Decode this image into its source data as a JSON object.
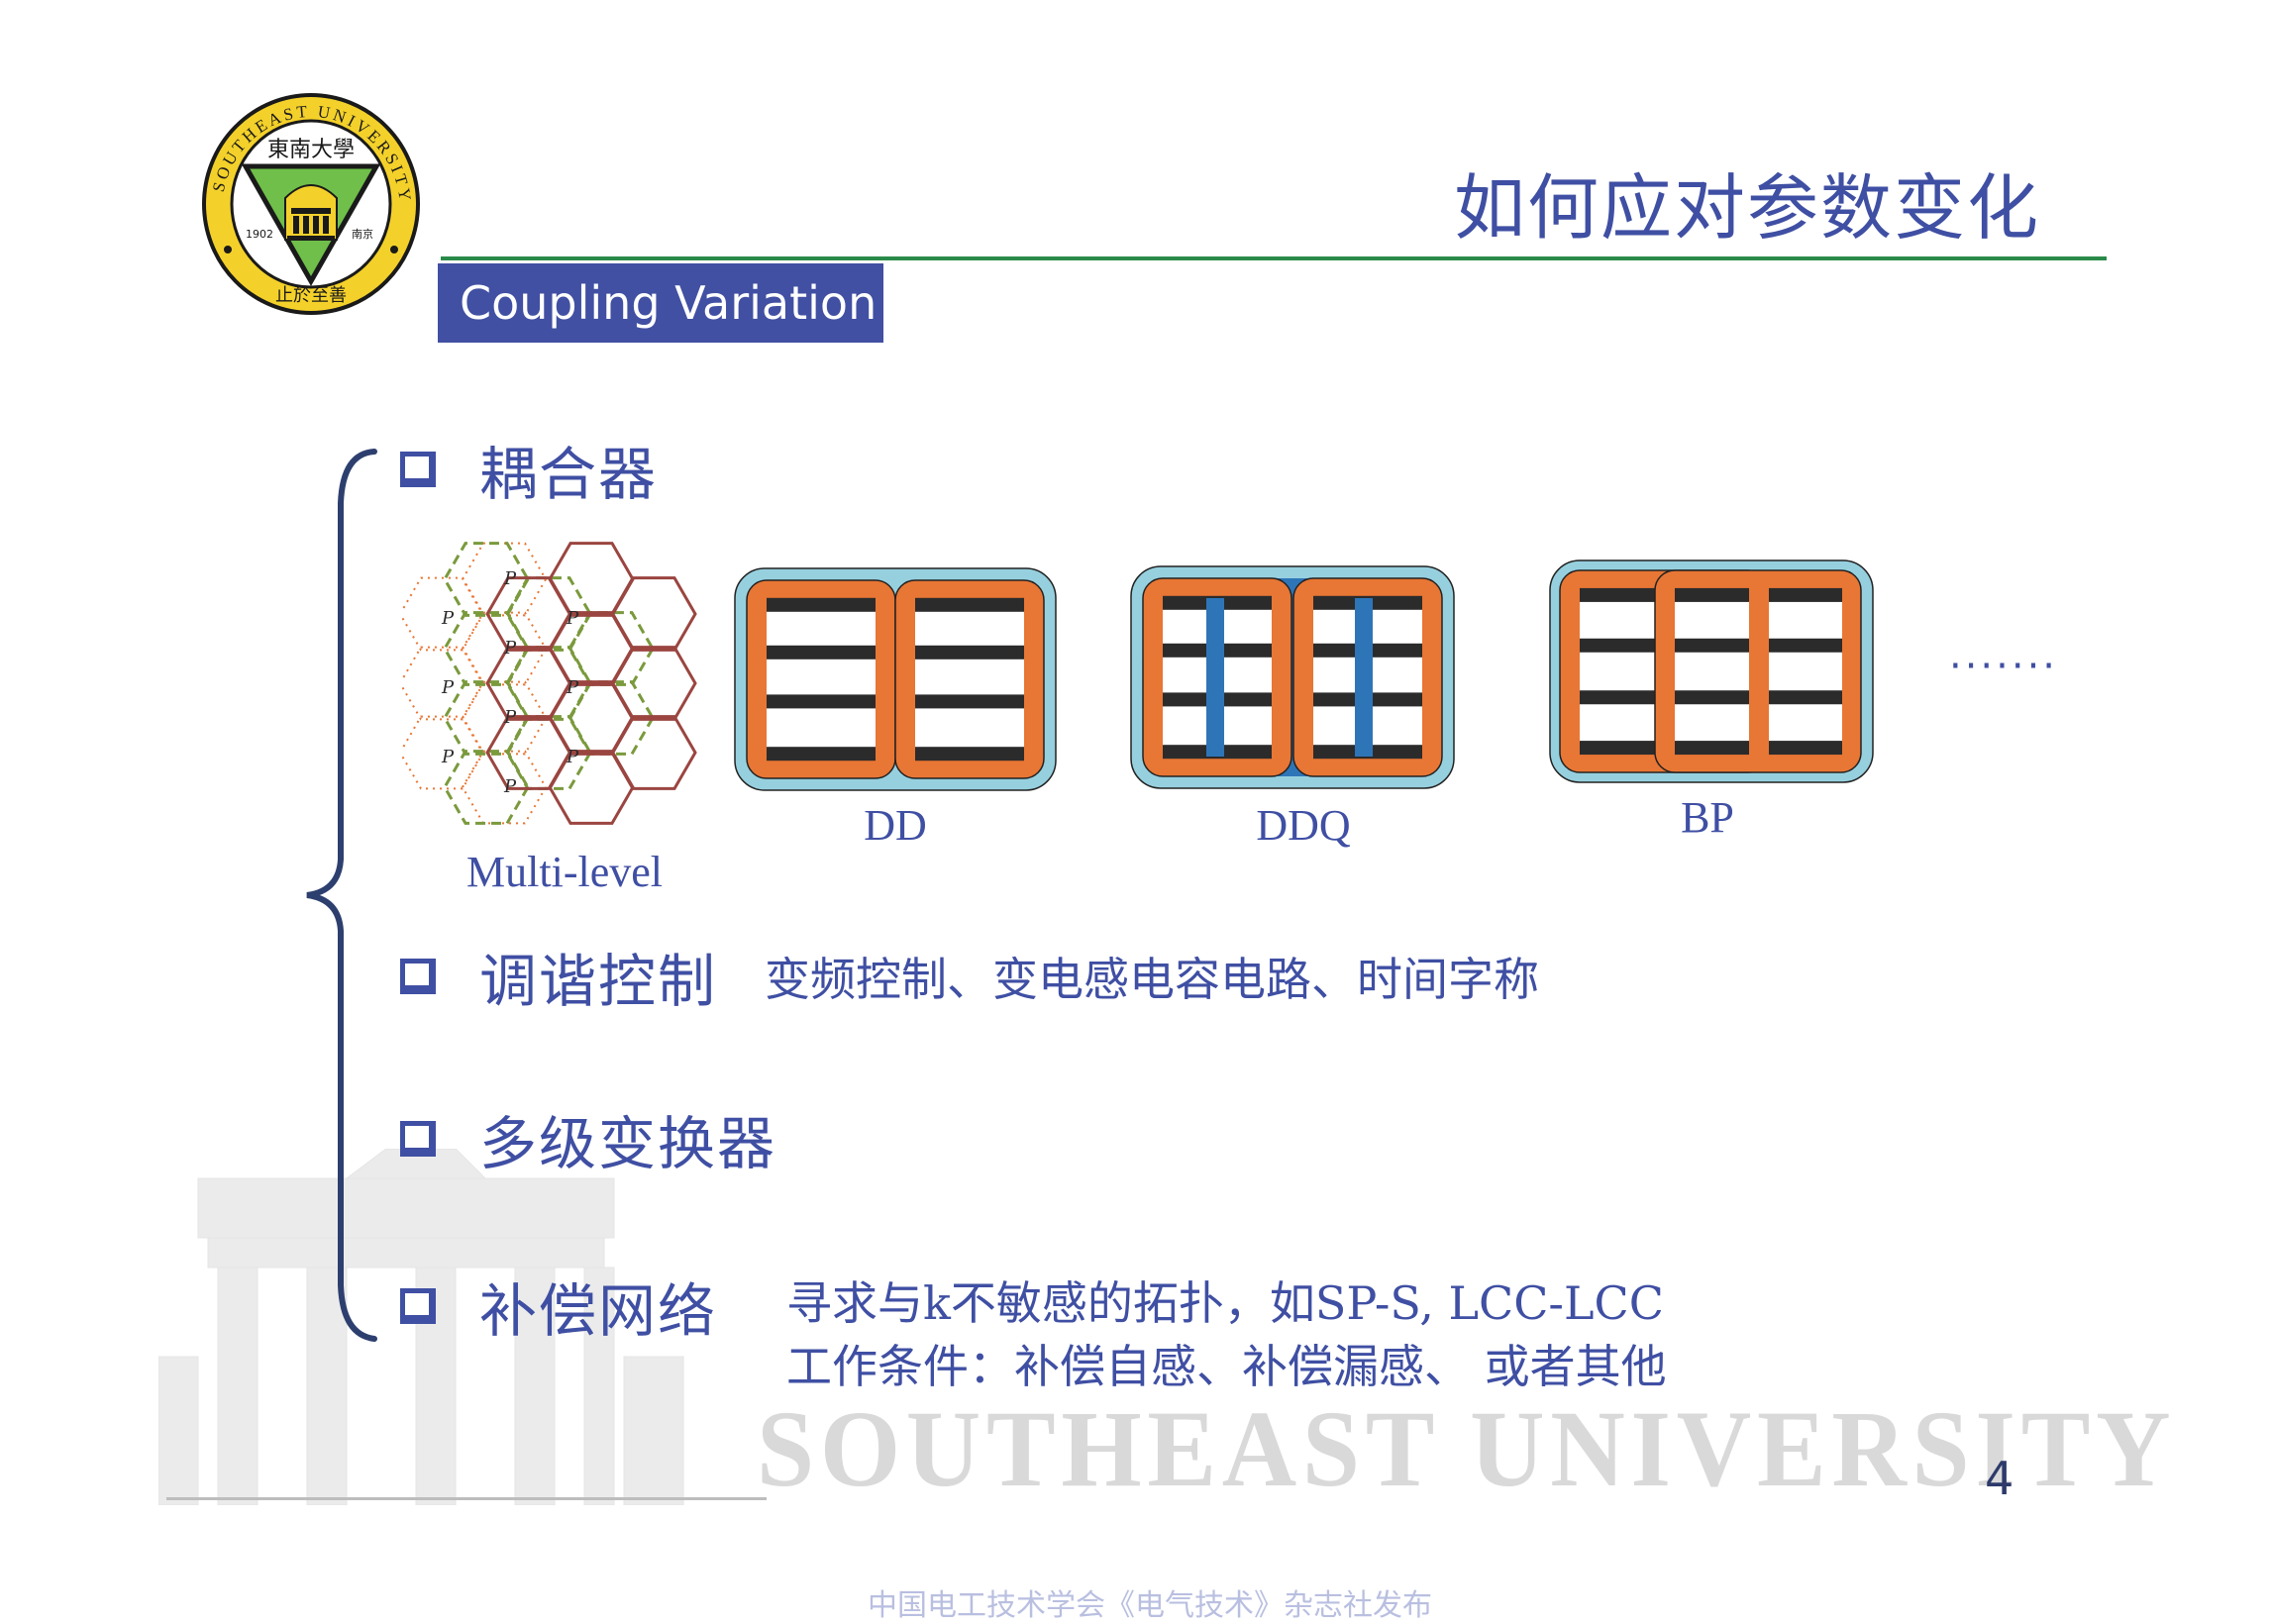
{
  "logo": {
    "ring_text": "SOUTHEAST UNIVERSITY",
    "chinese_name": "東南大學",
    "year": "1902",
    "city": "南京",
    "motto": "止於至善"
  },
  "slide": {
    "title": "如何应对参数变化",
    "subtitle": "Coupling Variation",
    "page_number": "4"
  },
  "items": [
    {
      "heading": "耦合器",
      "body": ""
    },
    {
      "heading": "调谐控制",
      "body": "变频控制、变电感电容电路、时间字称"
    },
    {
      "heading": "多级变换器",
      "body": ""
    },
    {
      "heading": "补偿网络",
      "body_lines": [
        "寻求与k不敏感的拓扑，如SP-S, LCC-LCC",
        "工作条件：补偿自感、补偿漏感、 或者其他"
      ]
    }
  ],
  "figures": {
    "multilevel": {
      "label": "Multi-level",
      "p_label": "P"
    },
    "dd": {
      "label": "DD"
    },
    "ddq": {
      "label": "DDQ"
    },
    "bp": {
      "label": "BP"
    },
    "ellipsis": "·······"
  },
  "watermark": {
    "text": "SOUTHEAST UNIVERSITY"
  },
  "footer": {
    "text": "中国电工技术学会《电气技术》杂志社发布"
  },
  "colors": {
    "primary_blue": "#3f4fa3",
    "box_blue": "#4150a2",
    "green_rule": "#2a8a4a",
    "coil_orange": "#e87634",
    "ferrite_cyan": "#96d0df",
    "ddq_blue": "#2e75b8",
    "hex_red": "#9b4540",
    "hex_green": "#7a9a3c"
  }
}
